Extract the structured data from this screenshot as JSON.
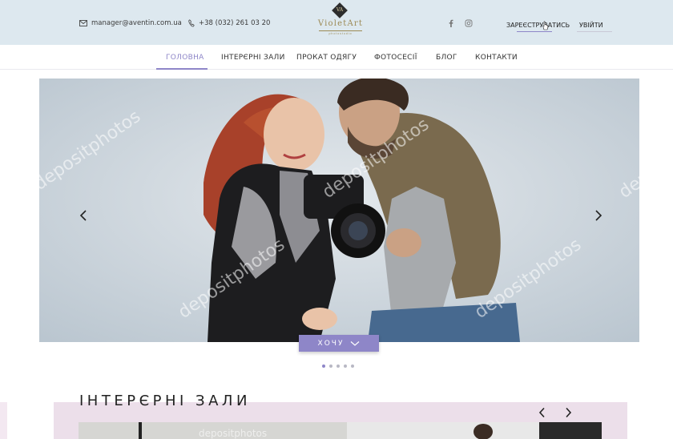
{
  "header": {
    "email": "manager@aventin.com.ua",
    "phone": "+38 (032) 261 03 20",
    "logo": {
      "mark": "VA",
      "name": "VioletArt",
      "tagline": "photostudio"
    },
    "social_icons": [
      "facebook-icon",
      "instagram-icon"
    ],
    "register_label": "ЗАРЕЄСТРУВАТИСЬ",
    "login_label": "УВІЙТИ"
  },
  "nav": {
    "items": [
      {
        "label": "ГОЛОВНА",
        "active": true
      },
      {
        "label": "ІНТЕРЄРНІ ЗАЛИ",
        "active": false
      },
      {
        "label": "ПРОКАТ ОДЯГУ",
        "active": false
      },
      {
        "label": "ФОТОСЕСІЇ",
        "active": false
      },
      {
        "label": "БЛОГ",
        "active": false
      },
      {
        "label": "КОНТАКТИ",
        "active": false
      }
    ]
  },
  "hero": {
    "button_label": "ХОЧУ",
    "slides_count": 5,
    "active_slide": 1,
    "watermark": "depositphotos"
  },
  "interiors": {
    "title": "ІНТЕРЄРНІ ЗАЛИ"
  },
  "colors": {
    "accent": "#8e86c8",
    "topbar_bg": "#dde8ef",
    "logo_gold": "#9c8a55",
    "section_bg": "#ecdfea"
  }
}
